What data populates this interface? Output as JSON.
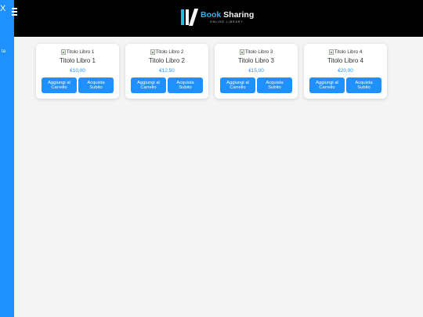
{
  "header": {
    "brand_word1": "Book",
    "brand_word2": "Sharing",
    "brand_tagline": "ONLINE LIBRARY",
    "brand_color": "#31b3e6",
    "background": "#000000"
  },
  "sidebar": {
    "close_symbol": "X",
    "link_label": "ta",
    "color": "#1e90ff"
  },
  "menu_icon": "hamburger-icon",
  "products": [
    {
      "image_alt": "Titolo Libro 1",
      "title": "Titolo Libro 1",
      "price": "€10,00",
      "cart_label": "Aggiungi al Carrello",
      "buy_label": "Acquista Subito"
    },
    {
      "image_alt": "Titolo Libro 2",
      "title": "Titolo Libro 2",
      "price": "€12,50",
      "cart_label": "Aggiungi al Carrello",
      "buy_label": "Acquista Subito"
    },
    {
      "image_alt": "Titolo Libro 3",
      "title": "Titolo Libro 3",
      "price": "€15,00",
      "cart_label": "Aggiungi al Carrello",
      "buy_label": "Acquista Subito"
    },
    {
      "image_alt": "Titolo Libro 4",
      "title": "Titolo Libro 4",
      "price": "€20,00",
      "cart_label": "Aggiungi al Carrello",
      "buy_label": "Acquista Subito"
    }
  ]
}
